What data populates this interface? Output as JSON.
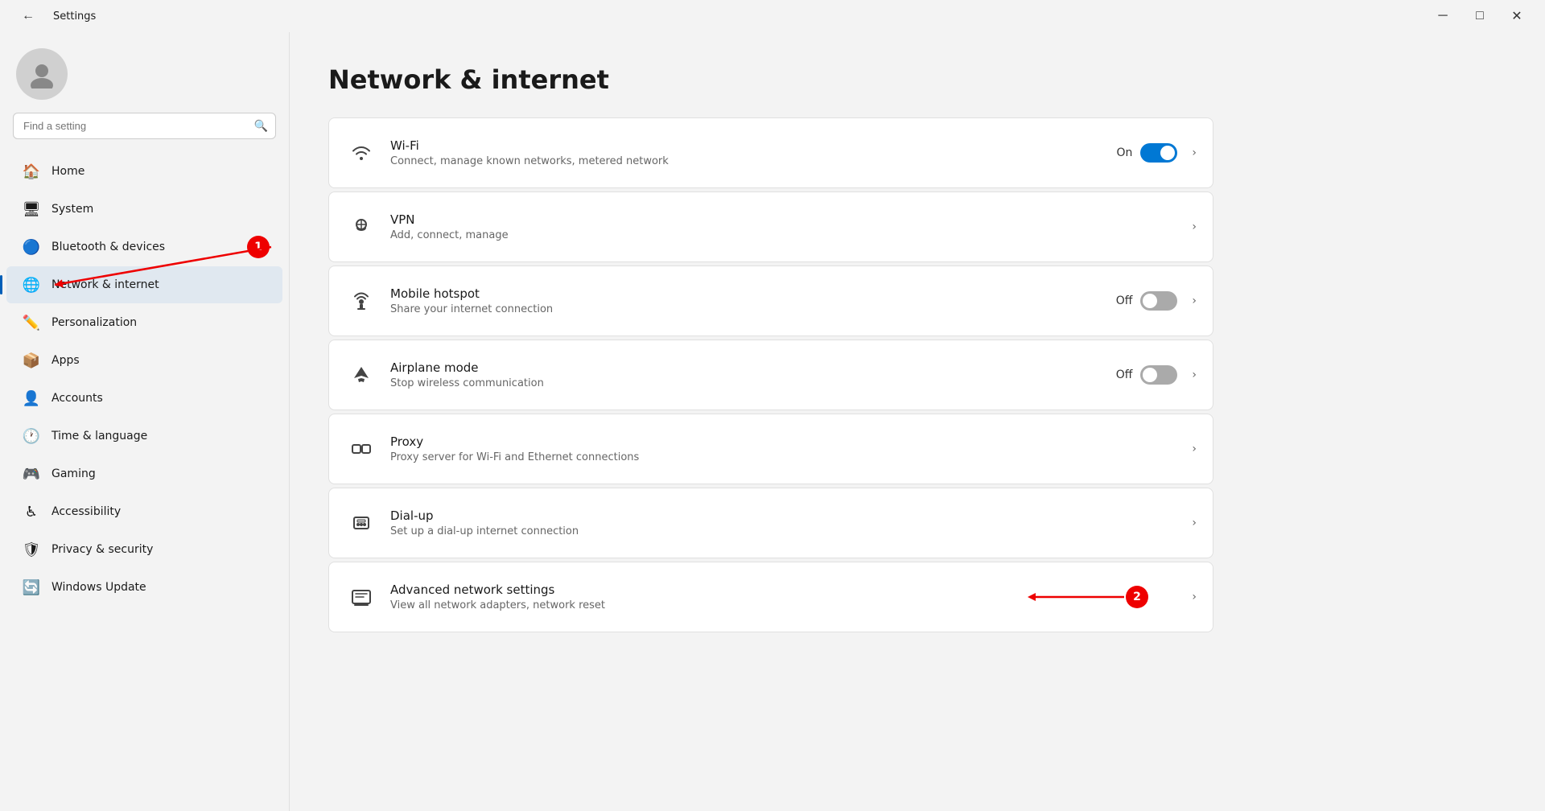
{
  "window": {
    "title": "Settings",
    "controls": {
      "minimize": "─",
      "maximize": "□",
      "close": "✕"
    }
  },
  "sidebar": {
    "search_placeholder": "Find a setting",
    "nav_items": [
      {
        "id": "home",
        "label": "Home",
        "icon": "🏠",
        "active": false
      },
      {
        "id": "system",
        "label": "System",
        "icon": "🖥",
        "active": false
      },
      {
        "id": "bluetooth",
        "label": "Bluetooth & devices",
        "icon": "🔵",
        "active": false
      },
      {
        "id": "network",
        "label": "Network & internet",
        "icon": "🌐",
        "active": true
      },
      {
        "id": "personalization",
        "label": "Personalization",
        "icon": "✏️",
        "active": false
      },
      {
        "id": "apps",
        "label": "Apps",
        "icon": "📦",
        "active": false
      },
      {
        "id": "accounts",
        "label": "Accounts",
        "icon": "👤",
        "active": false
      },
      {
        "id": "time",
        "label": "Time & language",
        "icon": "🕐",
        "active": false
      },
      {
        "id": "gaming",
        "label": "Gaming",
        "icon": "🎮",
        "active": false
      },
      {
        "id": "accessibility",
        "label": "Accessibility",
        "icon": "♿",
        "active": false
      },
      {
        "id": "privacy",
        "label": "Privacy & security",
        "icon": "🛡",
        "active": false
      },
      {
        "id": "update",
        "label": "Windows Update",
        "icon": "🔄",
        "active": false
      }
    ]
  },
  "main": {
    "page_title": "Network & internet",
    "settings": [
      {
        "id": "wifi",
        "title": "Wi-Fi",
        "subtitle": "Connect, manage known networks, metered network",
        "has_toggle": true,
        "toggle_state": "on",
        "toggle_label": "On",
        "has_chevron": true,
        "icon": "wifi"
      },
      {
        "id": "vpn",
        "title": "VPN",
        "subtitle": "Add, connect, manage",
        "has_toggle": false,
        "has_chevron": true,
        "icon": "vpn"
      },
      {
        "id": "hotspot",
        "title": "Mobile hotspot",
        "subtitle": "Share your internet connection",
        "has_toggle": true,
        "toggle_state": "off",
        "toggle_label": "Off",
        "has_chevron": true,
        "icon": "hotspot"
      },
      {
        "id": "airplane",
        "title": "Airplane mode",
        "subtitle": "Stop wireless communication",
        "has_toggle": true,
        "toggle_state": "off",
        "toggle_label": "Off",
        "has_chevron": true,
        "icon": "airplane"
      },
      {
        "id": "proxy",
        "title": "Proxy",
        "subtitle": "Proxy server for Wi-Fi and Ethernet connections",
        "has_toggle": false,
        "has_chevron": true,
        "icon": "proxy"
      },
      {
        "id": "dialup",
        "title": "Dial-up",
        "subtitle": "Set up a dial-up internet connection",
        "has_toggle": false,
        "has_chevron": true,
        "icon": "dialup"
      },
      {
        "id": "advanced",
        "title": "Advanced network settings",
        "subtitle": "View all network adapters, network reset",
        "has_toggle": false,
        "has_chevron": true,
        "icon": "advanced"
      }
    ]
  },
  "annotations": {
    "badge1_label": "1",
    "badge2_label": "2"
  }
}
